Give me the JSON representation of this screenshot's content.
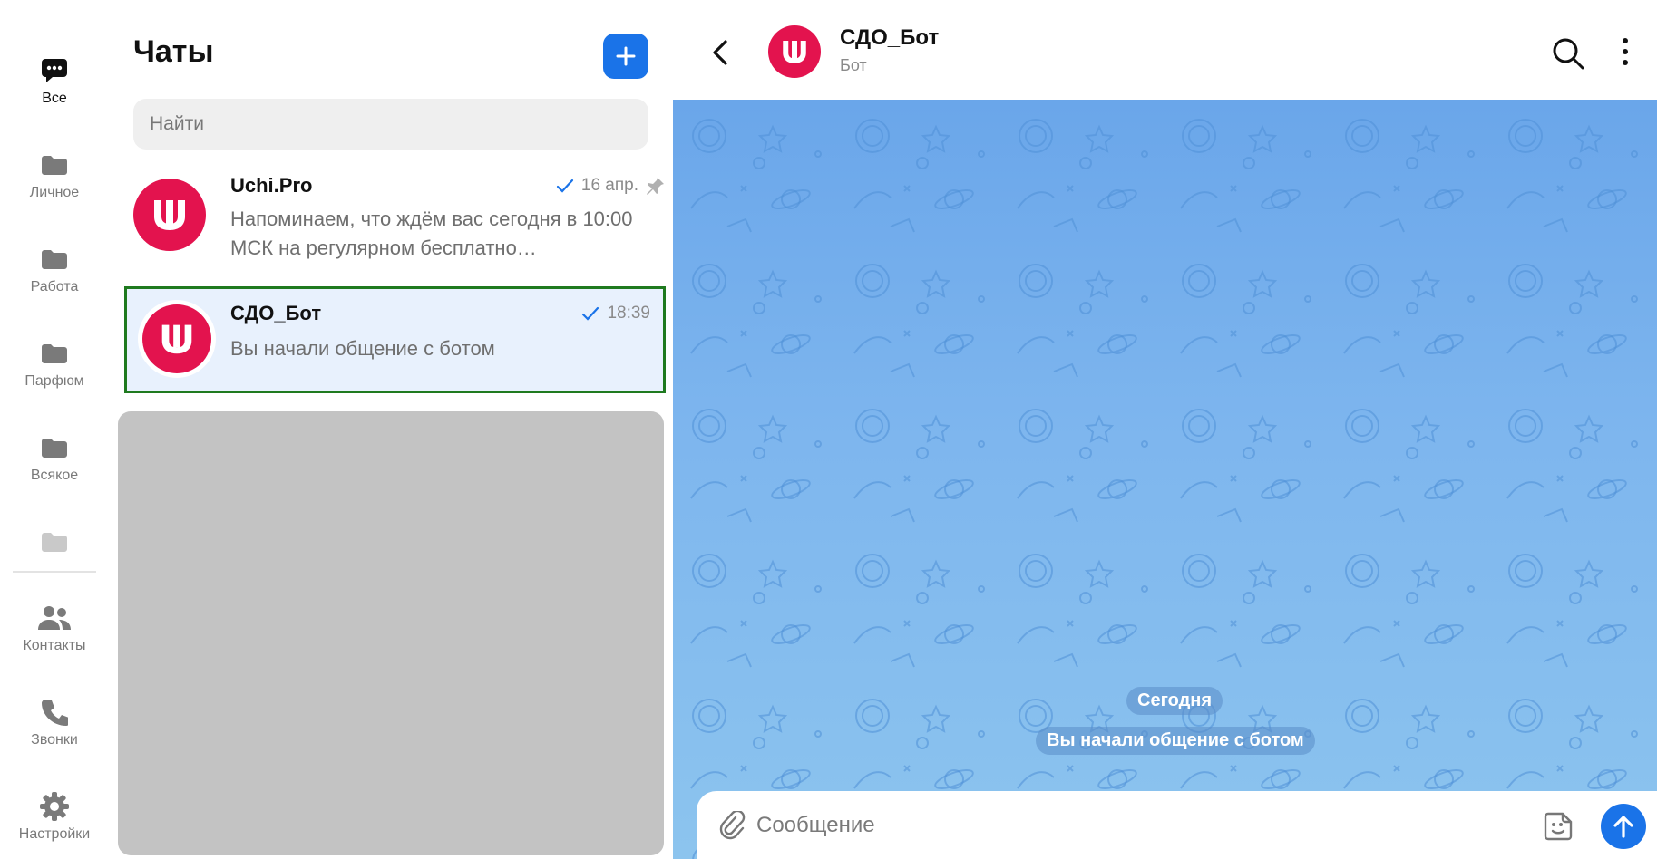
{
  "folders": {
    "items": [
      {
        "label": "Все",
        "icon": "chat-bubble-icon"
      },
      {
        "label": "Личное",
        "icon": "folder-icon"
      },
      {
        "label": "Работа",
        "icon": "folder-icon"
      },
      {
        "label": "Парфюм",
        "icon": "folder-icon"
      },
      {
        "label": "Всякое",
        "icon": "folder-icon"
      },
      {
        "label": "",
        "icon": "folder-icon"
      }
    ],
    "bottom": [
      {
        "label": "Контакты",
        "icon": "contacts-icon"
      },
      {
        "label": "Звонки",
        "icon": "phone-icon"
      },
      {
        "label": "Настройки",
        "icon": "gear-icon"
      }
    ]
  },
  "chat_list": {
    "title": "Чаты",
    "search_placeholder": "Найти",
    "chats": [
      {
        "name": "Uchi.Pro",
        "date": "16 апр.",
        "preview": "Напоминаем, что ждём вас сегодня в 10:00 МСК на регулярном бесплатно…",
        "pinned": true,
        "read": true
      },
      {
        "name": "СДО_Бот",
        "date": "18:39",
        "preview": "Вы начали общение с ботом",
        "pinned": false,
        "read": true,
        "selected": true
      }
    ]
  },
  "conversation": {
    "name": "СДО_Бот",
    "subtitle": "Бот",
    "date_separator": "Сегодня",
    "service_message": "Вы начали общение с ботом",
    "input_placeholder": "Сообщение"
  },
  "colors": {
    "accent": "#1a73e8",
    "avatar": "#e3134e",
    "selection_border": "#1f7a1f",
    "wallpaper": "#7eb6ee"
  }
}
